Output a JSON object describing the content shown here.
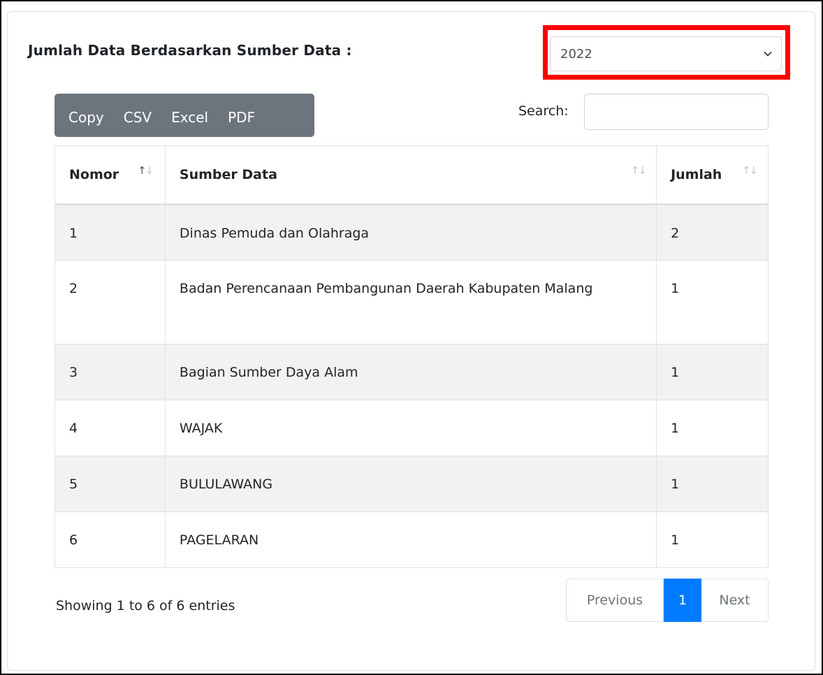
{
  "section": {
    "title": "Jumlah Data Berdasarkan Sumber Data :",
    "year_select": {
      "value": "2022",
      "icon": "chevron-down-icon"
    },
    "highlight_color": "#ff0000"
  },
  "toolbar": {
    "buttons": [
      "Copy",
      "CSV",
      "Excel",
      "PDF"
    ],
    "search_label": "Search:",
    "search_value": ""
  },
  "table": {
    "headers": [
      "Nomor",
      "Sumber Data",
      "Jumlah"
    ],
    "sort_icon": "sort-arrows-icon",
    "rows": [
      {
        "nomor": "1",
        "sumber": "Dinas Pemuda dan Olahraga",
        "jumlah": "2"
      },
      {
        "nomor": "2",
        "sumber": "Badan Perencanaan Pembangunan Daerah Kabupaten Malang",
        "jumlah": "1"
      },
      {
        "nomor": "3",
        "sumber": "Bagian Sumber Daya Alam",
        "jumlah": "1"
      },
      {
        "nomor": "4",
        "sumber": "WAJAK",
        "jumlah": "1"
      },
      {
        "nomor": "5",
        "sumber": "BULULAWANG",
        "jumlah": "1"
      },
      {
        "nomor": "6",
        "sumber": "PAGELARAN",
        "jumlah": "1"
      }
    ]
  },
  "footer": {
    "info": "Showing 1 to 6 of 6 entries",
    "pagination": {
      "previous": "Previous",
      "current": "1",
      "next": "Next"
    }
  },
  "colors": {
    "button_group": "#6c757d",
    "active_page": "#007bff",
    "striped_row": "#f2f2f2"
  }
}
